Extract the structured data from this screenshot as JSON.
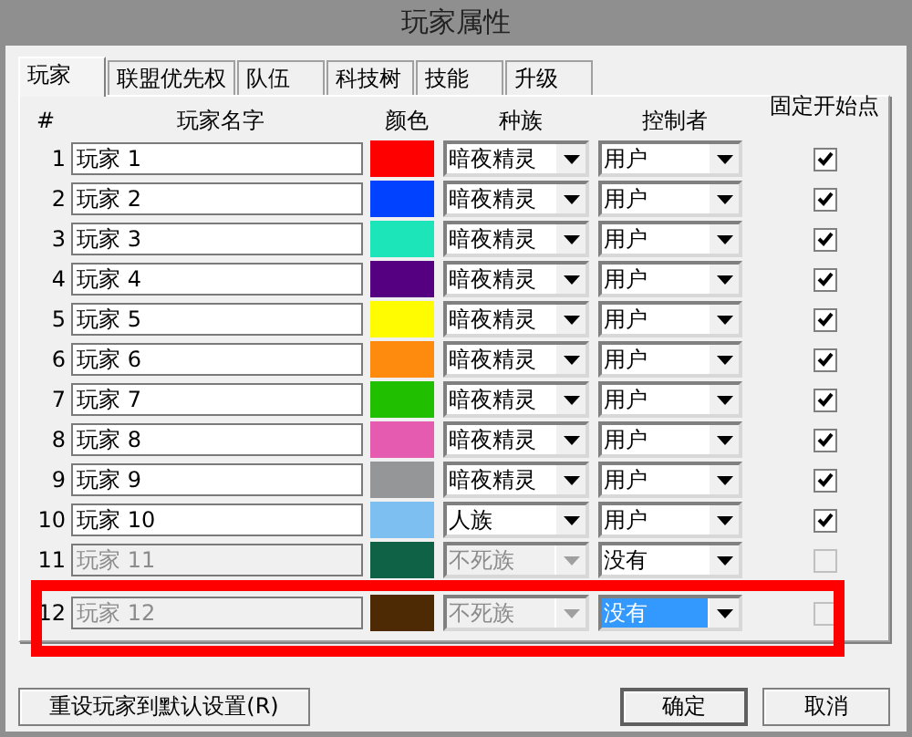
{
  "window": {
    "title": "玩家属性"
  },
  "tabs": [
    {
      "label": "玩家",
      "selected": true
    },
    {
      "label": "联盟优先权",
      "selected": false
    },
    {
      "label": "队伍",
      "selected": false
    },
    {
      "label": "科技树",
      "selected": false
    },
    {
      "label": "技能",
      "selected": false
    },
    {
      "label": "升级",
      "selected": false
    }
  ],
  "table": {
    "columns": [
      "#",
      "玩家名字",
      "颜色",
      "种族",
      "控制者",
      "固定开始点"
    ],
    "rows": [
      {
        "number": "1",
        "name": "玩家 1",
        "color": "#ff0000",
        "race": "暗夜精灵",
        "controller": "用户",
        "fixed_start": true,
        "disabled": false,
        "highlighted": false
      },
      {
        "number": "2",
        "name": "玩家 2",
        "color": "#0042ff",
        "race": "暗夜精灵",
        "controller": "用户",
        "fixed_start": true,
        "disabled": false,
        "highlighted": false
      },
      {
        "number": "3",
        "name": "玩家 3",
        "color": "#1ce6b9",
        "race": "暗夜精灵",
        "controller": "用户",
        "fixed_start": true,
        "disabled": false,
        "highlighted": false
      },
      {
        "number": "4",
        "name": "玩家 4",
        "color": "#540081",
        "race": "暗夜精灵",
        "controller": "用户",
        "fixed_start": true,
        "disabled": false,
        "highlighted": false
      },
      {
        "number": "5",
        "name": "玩家 5",
        "color": "#fffc01",
        "race": "暗夜精灵",
        "controller": "用户",
        "fixed_start": true,
        "disabled": false,
        "highlighted": false
      },
      {
        "number": "6",
        "name": "玩家 6",
        "color": "#fe8a0e",
        "race": "暗夜精灵",
        "controller": "用户",
        "fixed_start": true,
        "disabled": false,
        "highlighted": false
      },
      {
        "number": "7",
        "name": "玩家 7",
        "color": "#20c000",
        "race": "暗夜精灵",
        "controller": "用户",
        "fixed_start": true,
        "disabled": false,
        "highlighted": false
      },
      {
        "number": "8",
        "name": "玩家 8",
        "color": "#e55bb0",
        "race": "暗夜精灵",
        "controller": "用户",
        "fixed_start": true,
        "disabled": false,
        "highlighted": false
      },
      {
        "number": "9",
        "name": "玩家 9",
        "color": "#959697",
        "race": "暗夜精灵",
        "controller": "用户",
        "fixed_start": true,
        "disabled": false,
        "highlighted": false
      },
      {
        "number": "10",
        "name": "玩家 10",
        "color": "#7ebff1",
        "race": "人族",
        "controller": "用户",
        "fixed_start": true,
        "disabled": false,
        "highlighted": false
      },
      {
        "number": "11",
        "name": "玩家 11",
        "color": "#106246",
        "race": "不死族",
        "controller": "没有",
        "fixed_start": false,
        "disabled": true,
        "highlighted": false
      },
      {
        "number": "12",
        "name": "玩家 12",
        "color": "#4e2a04",
        "race": "不死族",
        "controller": "没有",
        "fixed_start": false,
        "disabled": true,
        "highlighted": true
      }
    ]
  },
  "buttons": {
    "reset": "重设玩家到默认设置(R)",
    "ok": "确定",
    "cancel": "取消"
  }
}
